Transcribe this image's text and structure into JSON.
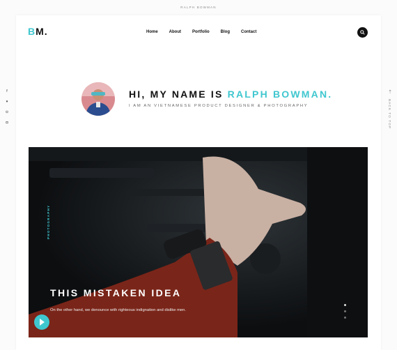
{
  "site_label": "RALPH BOWMAN",
  "logo": {
    "b": "B",
    "rest": "M."
  },
  "nav": [
    "Home",
    "About",
    "Portfolio",
    "Blog",
    "Contact"
  ],
  "intro": {
    "greeting": "HI, MY NAME IS ",
    "name": "RALPH BOWMAN.",
    "subtitle": "I AM AN VIETNAMESE PRODUCT DESIGNER & PHOTOGRAPHY"
  },
  "hero": {
    "tag": "PHOTOGRAPHY",
    "title": "THIS MISTAKEN IDEA",
    "description": "On the other hand, we denounce with righteous indignation and dislike men."
  },
  "back_to_top": "BACK TO TOP",
  "social_icons": [
    "facebook-icon",
    "twitter-icon",
    "pinterest-icon",
    "instagram-icon"
  ],
  "colors": {
    "accent": "#3fc7cf"
  }
}
